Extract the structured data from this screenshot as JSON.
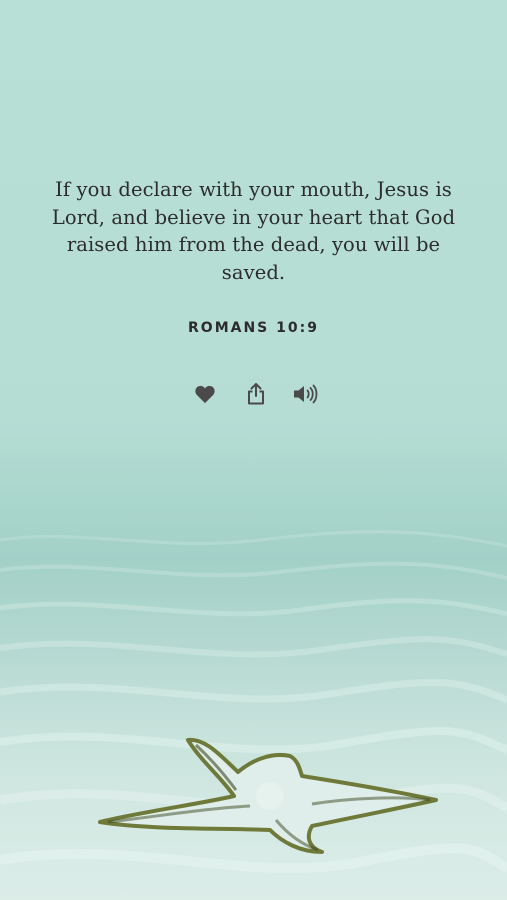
{
  "verse": {
    "text": "If you declare with your mouth, Jesus is Lord, and believe in your heart that God raised him from the dead, you will be saved.",
    "reference": "ROMANS 10:9"
  },
  "actions": [
    {
      "name": "like",
      "icon": "heart-icon"
    },
    {
      "name": "share",
      "icon": "share-icon"
    },
    {
      "name": "audio",
      "icon": "speaker-icon"
    }
  ],
  "colors": {
    "text": "#2c2c2c",
    "background": "#b8e0d6",
    "icon": "#4a4a4a"
  }
}
